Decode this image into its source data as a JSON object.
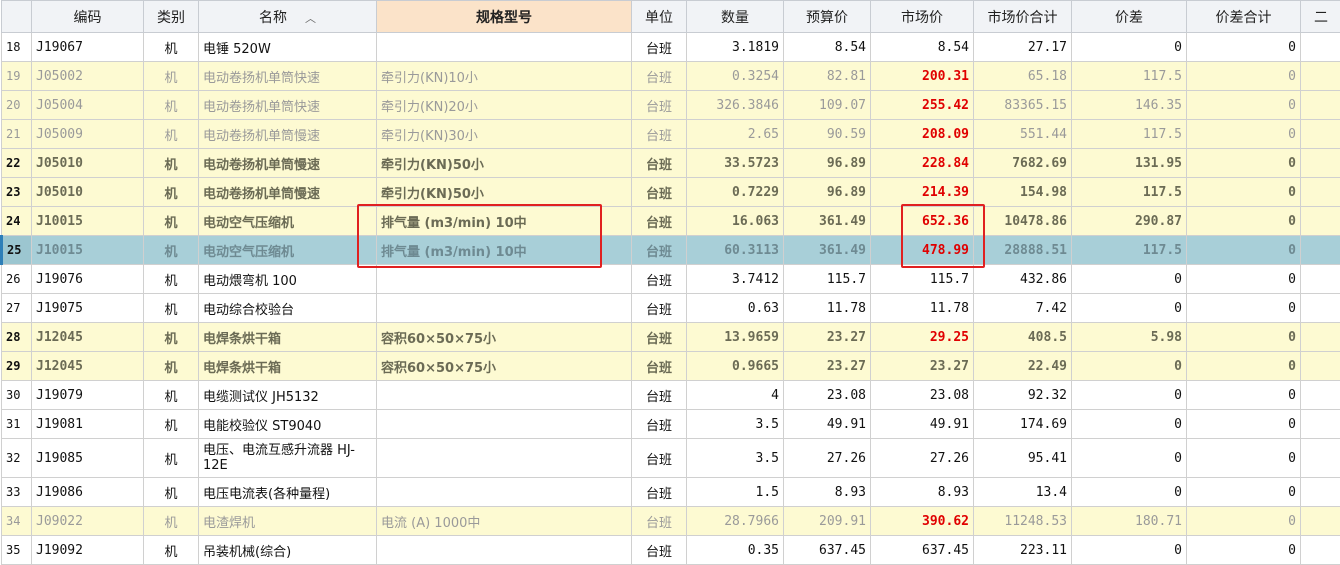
{
  "columns": {
    "code": "编码",
    "category": "类别",
    "name": "名称",
    "spec": "规格型号",
    "unit": "单位",
    "qty": "数量",
    "budget_price": "预算价",
    "market_price": "市场价",
    "market_total": "市场价合计",
    "price_diff": "价差",
    "diff_total": "价差合计",
    "extra": "二"
  },
  "sort_icon": "chevron-up-icon",
  "rows": [
    {
      "rn": "18",
      "code": "J19067",
      "cat": "机",
      "name": "电锤 520W",
      "spec": "",
      "unit": "台班",
      "qty": "3.1819",
      "budget": "8.54",
      "market": "8.54",
      "total": "27.17",
      "diff": "0",
      "difftotal": "0",
      "style": "plain",
      "red": false
    },
    {
      "rn": "19",
      "code": "J05002",
      "cat": "机",
      "name": "电动卷扬机单筒快速",
      "spec": "牵引力(KN)10小",
      "unit": "台班",
      "qty": "0.3254",
      "budget": "82.81",
      "market": "200.31",
      "total": "65.18",
      "diff": "117.5",
      "difftotal": "0",
      "style": "gray",
      "red": true
    },
    {
      "rn": "20",
      "code": "J05004",
      "cat": "机",
      "name": "电动卷扬机单筒快速",
      "spec": "牵引力(KN)20小",
      "unit": "台班",
      "qty": "326.3846",
      "budget": "109.07",
      "market": "255.42",
      "total": "83365.15",
      "diff": "146.35",
      "difftotal": "0",
      "style": "gray",
      "red": true
    },
    {
      "rn": "21",
      "code": "J05009",
      "cat": "机",
      "name": "电动卷扬机单筒慢速",
      "spec": "牵引力(KN)30小",
      "unit": "台班",
      "qty": "2.65",
      "budget": "90.59",
      "market": "208.09",
      "total": "551.44",
      "diff": "117.5",
      "difftotal": "0",
      "style": "gray",
      "red": true
    },
    {
      "rn": "22",
      "code": "J05010",
      "cat": "机",
      "name": "电动卷扬机单筒慢速",
      "spec": "牵引力(KN)50小",
      "unit": "台班",
      "qty": "33.5723",
      "budget": "96.89",
      "market": "228.84",
      "total": "7682.69",
      "diff": "131.95",
      "difftotal": "0",
      "style": "bold",
      "red": true
    },
    {
      "rn": "23",
      "code": "J05010",
      "cat": "机",
      "name": "电动卷扬机单筒慢速",
      "spec": "牵引力(KN)50小",
      "unit": "台班",
      "qty": "0.7229",
      "budget": "96.89",
      "market": "214.39",
      "total": "154.98",
      "diff": "117.5",
      "difftotal": "0",
      "style": "bold",
      "red": true
    },
    {
      "rn": "24",
      "code": "J10015",
      "cat": "机",
      "name": "电动空气压缩机",
      "spec": "排气量 (m3/min) 10中",
      "unit": "台班",
      "qty": "16.063",
      "budget": "361.49",
      "market": "652.36",
      "total": "10478.86",
      "diff": "290.87",
      "difftotal": "0",
      "style": "bold",
      "red": true
    },
    {
      "rn": "25",
      "code": "J10015",
      "cat": "机",
      "name": "电动空气压缩机",
      "spec": "排气量 (m3/min) 10中",
      "unit": "台班",
      "qty": "60.3113",
      "budget": "361.49",
      "market": "478.99",
      "total": "28888.51",
      "diff": "117.5",
      "difftotal": "0",
      "style": "selected",
      "red": true
    },
    {
      "rn": "26",
      "code": "J19076",
      "cat": "机",
      "name": "电动煨弯机 100",
      "spec": "",
      "unit": "台班",
      "qty": "3.7412",
      "budget": "115.7",
      "market": "115.7",
      "total": "432.86",
      "diff": "0",
      "difftotal": "0",
      "style": "plain",
      "red": false
    },
    {
      "rn": "27",
      "code": "J19075",
      "cat": "机",
      "name": "电动综合校验台",
      "spec": "",
      "unit": "台班",
      "qty": "0.63",
      "budget": "11.78",
      "market": "11.78",
      "total": "7.42",
      "diff": "0",
      "difftotal": "0",
      "style": "plain",
      "red": false
    },
    {
      "rn": "28",
      "code": "J12045",
      "cat": "机",
      "name": "电焊条烘干箱",
      "spec": "容积60×50×75小",
      "unit": "台班",
      "qty": "13.9659",
      "budget": "23.27",
      "market": "29.25",
      "total": "408.5",
      "diff": "5.98",
      "difftotal": "0",
      "style": "bold",
      "red": true
    },
    {
      "rn": "29",
      "code": "J12045",
      "cat": "机",
      "name": "电焊条烘干箱",
      "spec": "容积60×50×75小",
      "unit": "台班",
      "qty": "0.9665",
      "budget": "23.27",
      "market": "23.27",
      "total": "22.49",
      "diff": "0",
      "difftotal": "0",
      "style": "bold",
      "red": false
    },
    {
      "rn": "30",
      "code": "J19079",
      "cat": "机",
      "name": "电缆测试仪 JH5132",
      "spec": "",
      "unit": "台班",
      "qty": "4",
      "budget": "23.08",
      "market": "23.08",
      "total": "92.32",
      "diff": "0",
      "difftotal": "0",
      "style": "plain",
      "red": false
    },
    {
      "rn": "31",
      "code": "J19081",
      "cat": "机",
      "name": "电能校验仪 ST9040",
      "spec": "",
      "unit": "台班",
      "qty": "3.5",
      "budget": "49.91",
      "market": "49.91",
      "total": "174.69",
      "diff": "0",
      "difftotal": "0",
      "style": "plain",
      "red": false
    },
    {
      "rn": "32",
      "code": "J19085",
      "cat": "机",
      "name": "电压、电流互感升流器 HJ-12E",
      "spec": "",
      "unit": "台班",
      "qty": "3.5",
      "budget": "27.26",
      "market": "27.26",
      "total": "95.41",
      "diff": "0",
      "difftotal": "0",
      "style": "plain tall",
      "red": false
    },
    {
      "rn": "33",
      "code": "J19086",
      "cat": "机",
      "name": "电压电流表(各种量程)",
      "spec": "",
      "unit": "台班",
      "qty": "1.5",
      "budget": "8.93",
      "market": "8.93",
      "total": "13.4",
      "diff": "0",
      "difftotal": "0",
      "style": "plain",
      "red": false
    },
    {
      "rn": "34",
      "code": "J09022",
      "cat": "机",
      "name": "电渣焊机",
      "spec": "电流 (A) 1000中",
      "unit": "台班",
      "qty": "28.7966",
      "budget": "209.91",
      "market": "390.62",
      "total": "11248.53",
      "diff": "180.71",
      "difftotal": "0",
      "style": "gray",
      "red": true
    },
    {
      "rn": "35",
      "code": "J19092",
      "cat": "机",
      "name": "吊装机械(综合)",
      "spec": "",
      "unit": "台班",
      "qty": "0.35",
      "budget": "637.45",
      "market": "637.45",
      "total": "223.11",
      "diff": "0",
      "difftotal": "0",
      "style": "plain",
      "red": false
    }
  ]
}
